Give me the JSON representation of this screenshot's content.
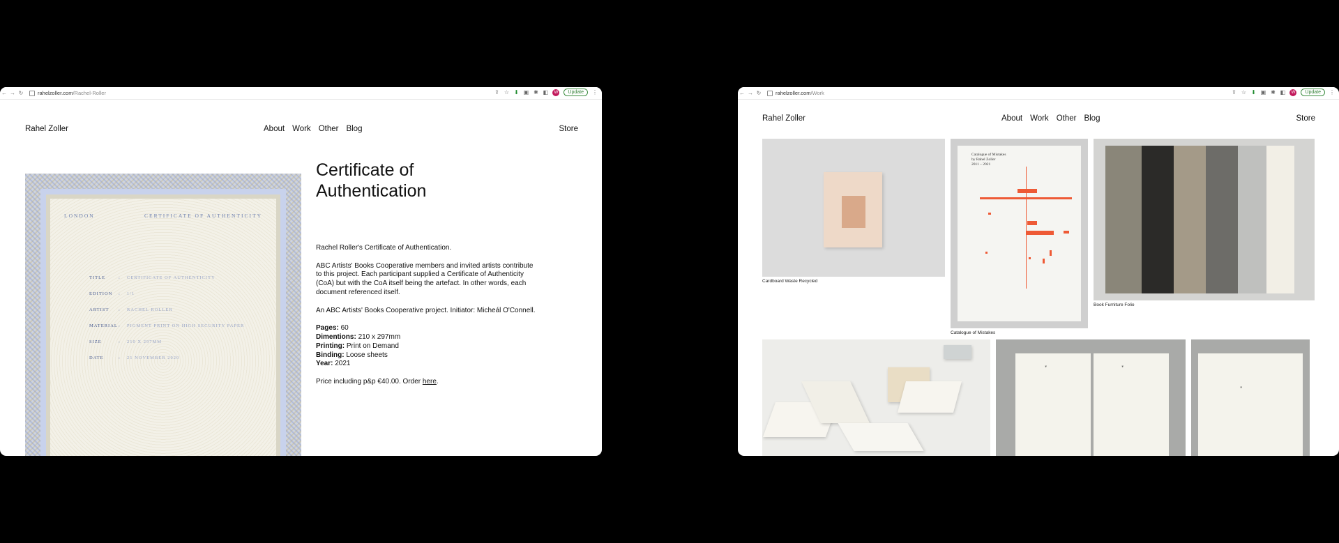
{
  "left": {
    "url": {
      "domain": "rahelzoller.com",
      "path": "/Rachel-Roller"
    },
    "update_label": "Update",
    "avatar_letter": "W",
    "brand": "Rahel Zoller",
    "nav": [
      "About",
      "Work",
      "Other",
      "Blog"
    ],
    "store": "Store",
    "certificate": {
      "city": "LONDON",
      "heading": "CERTIFICATE OF AUTHENTICITY",
      "fields": [
        {
          "k": "TITLE",
          "v": "CERTIFICATE OF AUTHENTICITY"
        },
        {
          "k": "EDITION",
          "v": "1/1"
        },
        {
          "k": "ARTIST",
          "v": "RACHEL ROLLER"
        },
        {
          "k": "MATERIAL",
          "v": "PIGMENT PRINT ON HIGH SECURITY PAPER"
        },
        {
          "k": "SIZE",
          "v": "210 X 297MM"
        },
        {
          "k": "DATE",
          "v": "21 NOVEMBER 2020"
        }
      ]
    },
    "product": {
      "title": "Certificate of Authentication",
      "intro": "Rachel Roller's Certificate of Authentication.",
      "body": "ABC Artists' Books Cooperative members and invited artists contribute to this project. Each participant supplied a Certificate of Authenticity (CoA) but with the CoA itself being the artefact. In other words, each document referenced itself.",
      "credit": "An ABC Artists' Books Cooperative project. Initiator: Micheál O'Connell.",
      "specs": [
        {
          "k": "Pages:",
          "v": "60"
        },
        {
          "k": "Dimentions:",
          "v": "210 x 297mm"
        },
        {
          "k": "Printing:",
          "v": "Print on Demand"
        },
        {
          "k": "Binding:",
          "v": "Loose sheets"
        },
        {
          "k": "Year:",
          "v": "2021"
        }
      ],
      "price_text": "Price including p&p €40.00. Order",
      "order_link": "here",
      "period": "."
    }
  },
  "right": {
    "url": {
      "domain": "rahelzoller.com",
      "path": "/Work"
    },
    "update_label": "Update",
    "avatar_letter": "W",
    "brand": "Rahel Zoller",
    "nav": [
      "About",
      "Work",
      "Other",
      "Blog"
    ],
    "store": "Store",
    "works": [
      {
        "caption": "Cardboard Waste Recycled"
      },
      {
        "caption": "Catalogue of Mistakes",
        "cover_title": "Catalogue of Mistakes\nby Rahel Zoller\n2011 – 2021"
      },
      {
        "caption": "Book Furniture Folio"
      }
    ]
  },
  "colors": {
    "update_green": "#2e7d32",
    "accent_red": "#ee5a36",
    "avatar": "#c2185b"
  }
}
